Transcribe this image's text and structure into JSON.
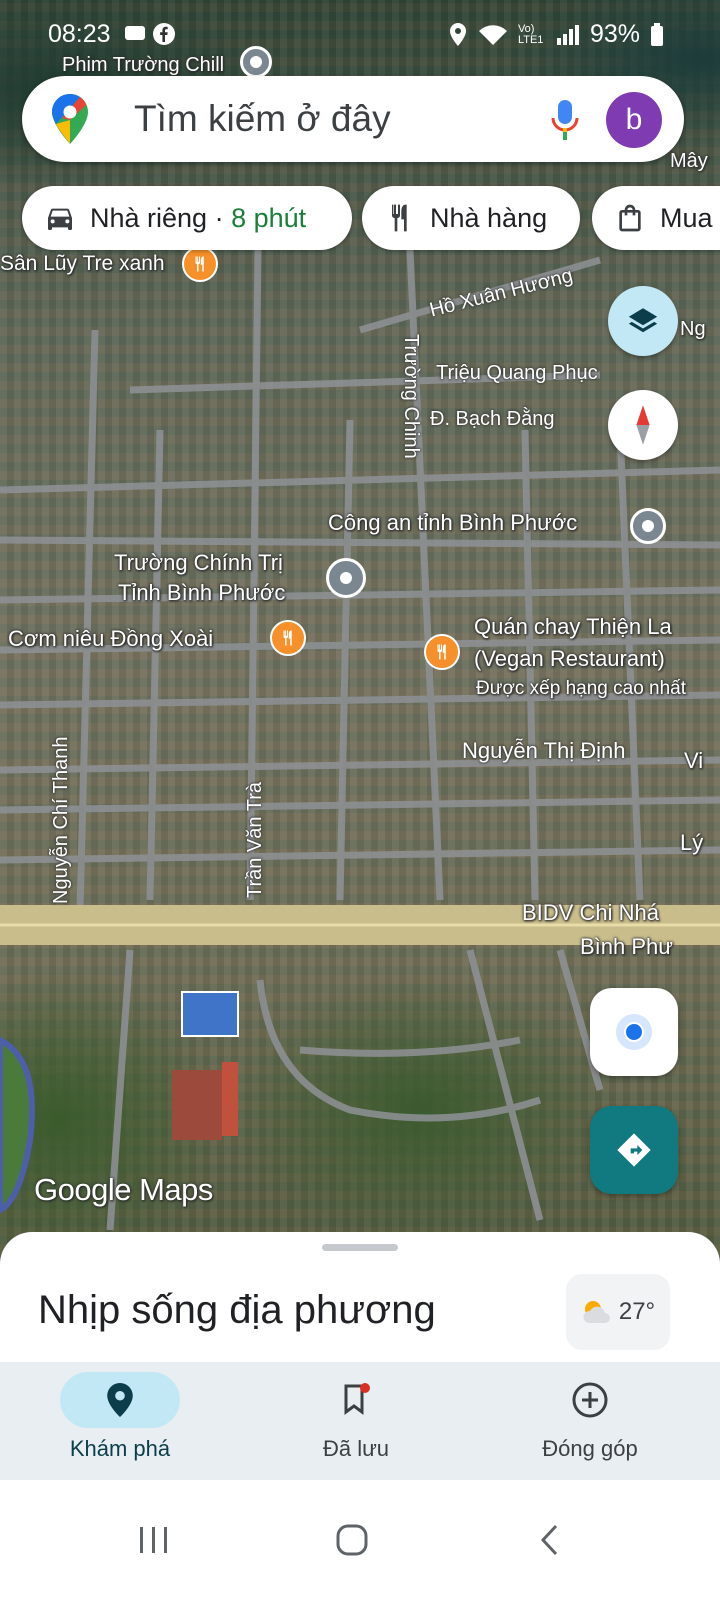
{
  "status_bar": {
    "time": "08:23",
    "battery": "93%",
    "network": "Vo) LTE1"
  },
  "search": {
    "placeholder": "Tìm kiếm ở đây",
    "avatar_letter": "b"
  },
  "chips": [
    {
      "label": "Nhà riêng",
      "separator": " · ",
      "time": "8 phút",
      "icon": "car-icon"
    },
    {
      "label": "Nhà hàng",
      "icon": "fork-knife-icon"
    },
    {
      "label": "Mua",
      "icon": "shopping-bag-icon"
    }
  ],
  "map": {
    "places": {
      "phim_truong": "Phim Trường Chill",
      "san_luy": "Sân Lũy Tre xanh",
      "may": "Mây",
      "cong_an": "Công an tỉnh Bình Phước",
      "truong_chinh_tri_1": "Trường Chính Trị",
      "truong_chinh_tri_2": "Tỉnh Bình Phước",
      "com_nieu": "Cơm niêu Đồng Xoài",
      "quan_chay_1": "Quán chay Thiện La",
      "quan_chay_2": "(Vegan Restaurant)",
      "quan_chay_3": "Được xếp hạng cao nhất",
      "bidv_1": "BIDV Chi Nhá",
      "bidv_2": "Bình Phư",
      "ng_partial": "Ng",
      "vi_partial": "Vi",
      "ly_partial": "Lý"
    },
    "roads": {
      "ho_xuan_huong": "Hồ Xuân Hương",
      "trieu_quang_phuc": "Triệu Quang Phục",
      "bach_dang": "Đ. Bạch Đằng",
      "truong_chinh": "Trường Chinh",
      "nguyen_thi_dinh": "Nguyễn Thị Định",
      "nguyen_chi_thanh": "Nguyễn Chí Thanh",
      "tran_van_tra": "Trần Văn Trà"
    },
    "logo": "Google Maps"
  },
  "bottom_sheet": {
    "title": "Nhịp sống địa phương",
    "weather": "27°",
    "weather_icon": "partly-cloudy-icon"
  },
  "nav": [
    {
      "label": "Khám phá",
      "icon": "explore-pin-icon",
      "active": true
    },
    {
      "label": "Đã lưu",
      "icon": "bookmark-icon",
      "active": false
    },
    {
      "label": "Đóng góp",
      "icon": "add-circle-icon",
      "active": false
    }
  ],
  "colors": {
    "accent_teal": "#117a80",
    "avatar_purple": "#7e3bb2",
    "poi_orange": "#f5902b",
    "green_text": "#188038"
  }
}
